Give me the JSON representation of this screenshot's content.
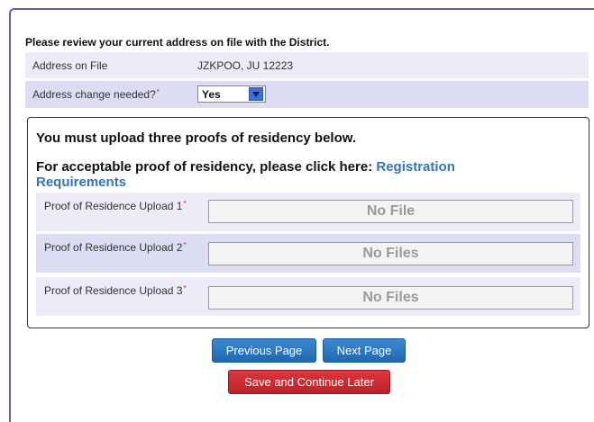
{
  "intro_text": "Please review your current address on file with the District.",
  "address_row": {
    "label": "Address on File",
    "value": "JZKPOO, JU 12223"
  },
  "change_row": {
    "label": "Address change needed?",
    "required_mark": "*",
    "selected_value": "Yes"
  },
  "upload_section": {
    "heading": "You must upload three proofs of residency below.",
    "proof_text": "For acceptable proof of residency, please click here:",
    "link_text": "Registration Requirements",
    "uploads": [
      {
        "label": "Proof of Residence Upload 1",
        "required_mark": "*",
        "status": "No File"
      },
      {
        "label": "Proof of Residence Upload 2",
        "required_mark": "*",
        "status": "No Files"
      },
      {
        "label": "Proof of Residence Upload 3",
        "required_mark": "*",
        "status": "No Files"
      }
    ]
  },
  "buttons": {
    "previous": "Previous Page",
    "next": "Next Page",
    "save": "Save and Continue Later"
  },
  "colors": {
    "frame": "#6f5a93",
    "row_light": "#ecebf8",
    "row_dark": "#dcdcf3",
    "link": "#2f75c0",
    "required": "#c0272d",
    "button_blue": "#1f68b3",
    "button_red": "#c01f27"
  }
}
